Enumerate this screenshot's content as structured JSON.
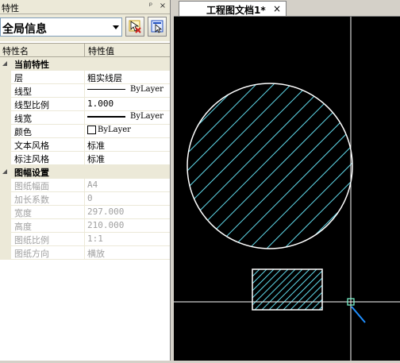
{
  "panel": {
    "title": "特性",
    "pin_glyph": "ᵖ",
    "close_glyph": "×",
    "selector_value": "全局信息",
    "toolbar_icons": [
      "select-objects-icon",
      "quick-select-icon"
    ],
    "header": {
      "name": "特性名",
      "value": "特性值"
    }
  },
  "categories": [
    {
      "label": "当前特性",
      "expanded": true,
      "rows": [
        {
          "name": "层",
          "value": "粗实线层",
          "kind": "text"
        },
        {
          "name": "线型",
          "value": "ByLayer",
          "kind": "line"
        },
        {
          "name": "线型比例",
          "value": "1.000",
          "kind": "mono"
        },
        {
          "name": "线宽",
          "value": "ByLayer",
          "kind": "thickline"
        },
        {
          "name": "颜色",
          "value": "ByLayer",
          "kind": "color"
        },
        {
          "name": "文本风格",
          "value": "标准",
          "kind": "text"
        },
        {
          "name": "标注风格",
          "value": "标准",
          "kind": "text"
        }
      ]
    },
    {
      "label": "图幅设置",
      "expanded": true,
      "rows": [
        {
          "name": "图纸幅面",
          "value": "A4",
          "kind": "mono",
          "disabled": true
        },
        {
          "name": "加长系数",
          "value": "0",
          "kind": "mono",
          "disabled": true
        },
        {
          "name": "宽度",
          "value": "297.000",
          "kind": "mono",
          "disabled": true
        },
        {
          "name": "高度",
          "value": "210.000",
          "kind": "mono",
          "disabled": true
        },
        {
          "name": "图纸比例",
          "value": "1:1",
          "kind": "mono",
          "disabled": true
        },
        {
          "name": "图纸方向",
          "value": "横放",
          "kind": "text",
          "disabled": true
        }
      ]
    }
  ],
  "document": {
    "tab_label": "工程图文档1*",
    "close_glyph": "×"
  },
  "colors": {
    "canvas_bg": "#000000",
    "outline": "#ffffff",
    "hatch": "#5fd7e8",
    "crosshair": "#ffffff",
    "cursor_box": "#7fffd4",
    "cursor_leader": "#1f8fff"
  }
}
